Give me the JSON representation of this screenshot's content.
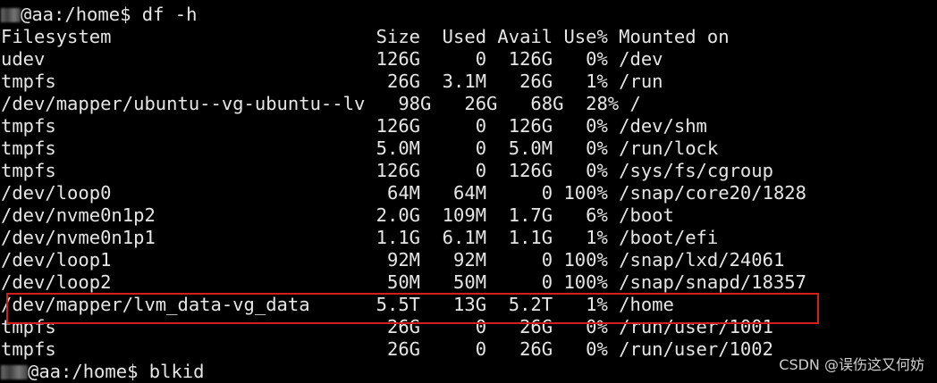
{
  "prompt1": {
    "host": "aa",
    "path": ":/home$",
    "command": "df -h"
  },
  "header": "Filesystem                        Size  Used Avail Use% Mounted on",
  "rows": [
    "udev                              126G     0  126G   0% /dev",
    "tmpfs                              26G  3.1M   26G   1% /run",
    "/dev/mapper/ubuntu--vg-ubuntu--lv   98G   26G   68G  28% /",
    "tmpfs                             126G     0  126G   0% /dev/shm",
    "tmpfs                             5.0M     0  5.0M   0% /run/lock",
    "tmpfs                             126G     0  126G   0% /sys/fs/cgroup",
    "/dev/loop0                         64M   64M     0 100% /snap/core20/1828",
    "/dev/nvme0n1p2                    2.0G  109M  1.7G   6% /boot",
    "/dev/nvme0n1p1                    1.1G  6.1M  1.1G   1% /boot/efi",
    "/dev/loop1                         92M   92M     0 100% /snap/lxd/24061",
    "/dev/loop2                         50M   50M     0 100% /snap/snapd/18357",
    "/dev/mapper/lvm_data-vg_data      5.5T   13G  5.2T   1% /home",
    "tmpfs                              26G     0   26G   0% /run/user/1001",
    "tmpfs                              26G     0   26G   0% /run/user/1002"
  ],
  "prompt2": {
    "host": "@aa",
    "path": ":/home$",
    "command": "blkid"
  },
  "watermark": "CSDN @误伤这又何妨"
}
